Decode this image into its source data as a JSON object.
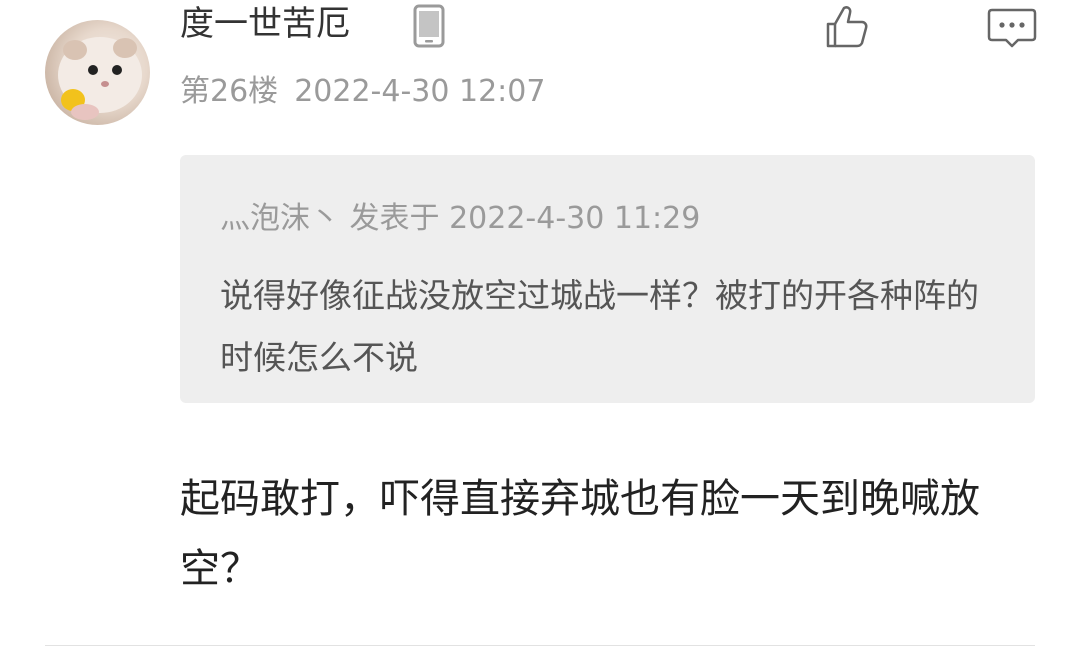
{
  "comment": {
    "username": "度一世苦厄",
    "floor": "第26楼",
    "timestamp": "2022-4-30 12:07",
    "body": "起码敢打，吓得直接弃城也有脸一天到晚喊放空？"
  },
  "quote": {
    "meta": "灬泡沫丶 发表于 2022-4-30 11:29",
    "text": "说得好像征战没放空过城战一样？被打的开各种阵的时候怎么不说"
  },
  "icons": {
    "device": "phone-icon",
    "like": "thumbs-up-icon",
    "reply": "comment-bubble-icon"
  },
  "colors": {
    "text_primary": "#333333",
    "text_secondary": "#9a9a9a",
    "quote_background": "#eeeeee"
  }
}
